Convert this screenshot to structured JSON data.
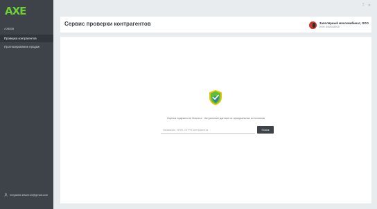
{
  "sidebar": {
    "logo": "AXE",
    "section_label": "AXE09",
    "items": [
      {
        "label": "Проверка контрагентов",
        "active": true
      },
      {
        "label": "Прогнозирование продаж",
        "active": false
      }
    ],
    "user_email": "megaobk.teskre10@gmail.com"
  },
  "topbar": {
    "controls": "? ✕"
  },
  "header": {
    "title": "Сервис проверки контрагентов",
    "company_name": "Заполярный мясокомбинат, ООО",
    "company_inn": "ИНН: 8905048025"
  },
  "main": {
    "tagline": "Оценка надежности бизнеса · Актуальные данные из официальных источников",
    "search_placeholder": "Название, ИНН, ОГРН контрагента",
    "search_button": "Поиск"
  },
  "colors": {
    "sidebar_bg": "#3d4349",
    "accent_green": "#6fcf3a",
    "shield_yellow": "#e6c400"
  }
}
